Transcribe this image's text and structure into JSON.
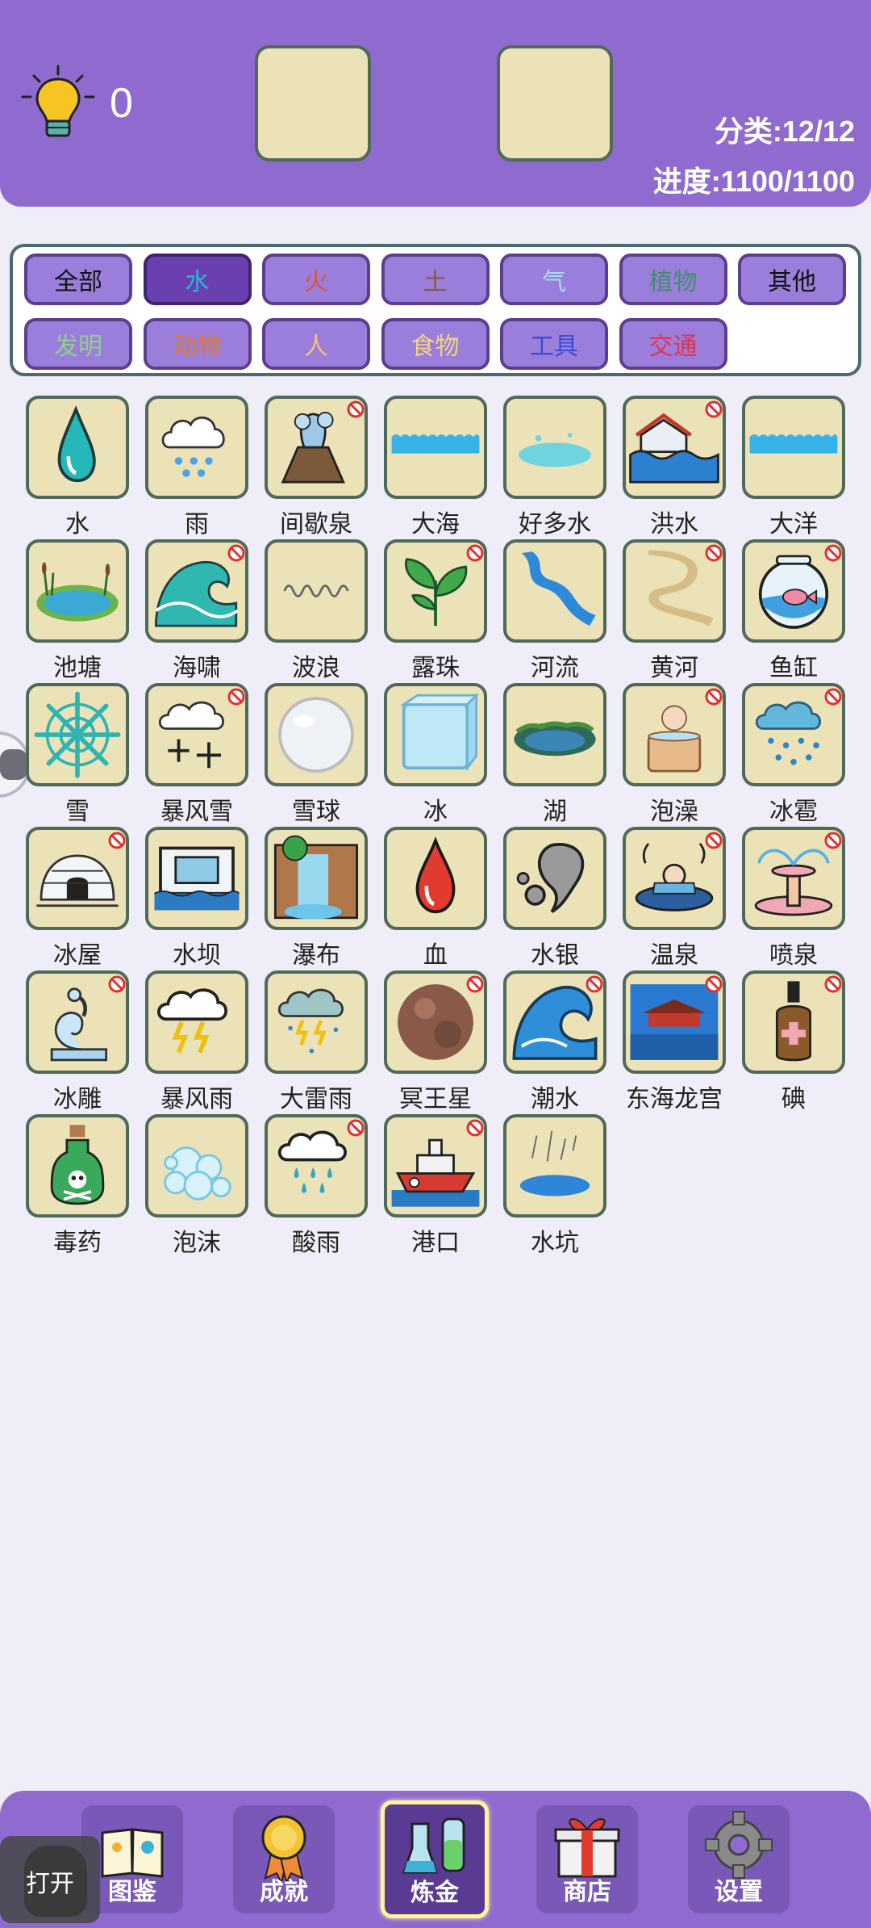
{
  "header": {
    "hint_count": "0",
    "category_stat": "分类:12/12",
    "progress_stat": "进度:1100/1100"
  },
  "filters": [
    {
      "label": "全部",
      "color": "#111111"
    },
    {
      "label": "水",
      "color": "#29b6d6"
    },
    {
      "label": "火",
      "color": "#e0533a"
    },
    {
      "label": "土",
      "color": "#8a5a32"
    },
    {
      "label": "气",
      "color": "#a9dcf2"
    },
    {
      "label": "植物",
      "color": "#3d8f6b"
    },
    {
      "label": "其他",
      "color": "#111111"
    },
    {
      "label": "发明",
      "color": "#8fd08a"
    },
    {
      "label": "动物",
      "color": "#e07a2a"
    },
    {
      "label": "人",
      "color": "#f3c27a"
    },
    {
      "label": "食物",
      "color": "#f1d57a"
    },
    {
      "label": "工具",
      "color": "#3a4bd4"
    },
    {
      "label": "交通",
      "color": "#e0354a"
    }
  ],
  "active_filter": "水",
  "elements": [
    {
      "name": "水",
      "icon": "water-drop-icon",
      "banned": false
    },
    {
      "name": "雨",
      "icon": "rain-cloud-icon",
      "banned": false
    },
    {
      "name": "间歇泉",
      "icon": "geyser-icon",
      "banned": true
    },
    {
      "name": "大海",
      "icon": "sea-icon",
      "banned": false
    },
    {
      "name": "好多水",
      "icon": "puddle-icon",
      "banned": false
    },
    {
      "name": "洪水",
      "icon": "flood-icon",
      "banned": true
    },
    {
      "name": "大洋",
      "icon": "ocean-icon",
      "banned": false
    },
    {
      "name": "池塘",
      "icon": "pond-icon",
      "banned": false
    },
    {
      "name": "海啸",
      "icon": "tsunami-icon",
      "banned": true
    },
    {
      "name": "波浪",
      "icon": "wave-line-icon",
      "banned": false
    },
    {
      "name": "露珠",
      "icon": "dew-plant-icon",
      "banned": true
    },
    {
      "name": "河流",
      "icon": "river-icon",
      "banned": false
    },
    {
      "name": "黄河",
      "icon": "yellow-river-icon",
      "banned": true
    },
    {
      "name": "鱼缸",
      "icon": "fishbowl-icon",
      "banned": true
    },
    {
      "name": "雪",
      "icon": "snowflake-icon",
      "banned": false
    },
    {
      "name": "暴风雪",
      "icon": "blizzard-icon",
      "banned": true
    },
    {
      "name": "雪球",
      "icon": "snowball-icon",
      "banned": false
    },
    {
      "name": "冰",
      "icon": "ice-cube-icon",
      "banned": false
    },
    {
      "name": "湖",
      "icon": "lake-icon",
      "banned": false
    },
    {
      "name": "泡澡",
      "icon": "bath-icon",
      "banned": true
    },
    {
      "name": "冰雹",
      "icon": "hail-icon",
      "banned": true
    },
    {
      "name": "冰屋",
      "icon": "igloo-icon",
      "banned": true
    },
    {
      "name": "水坝",
      "icon": "dam-icon",
      "banned": false
    },
    {
      "name": "瀑布",
      "icon": "waterfall-icon",
      "banned": false
    },
    {
      "name": "血",
      "icon": "blood-drop-icon",
      "banned": false
    },
    {
      "name": "水银",
      "icon": "mercury-icon",
      "banned": false
    },
    {
      "name": "温泉",
      "icon": "hot-spring-icon",
      "banned": true
    },
    {
      "name": "喷泉",
      "icon": "fountain-icon",
      "banned": true
    },
    {
      "name": "冰雕",
      "icon": "ice-swan-icon",
      "banned": true
    },
    {
      "name": "暴风雨",
      "icon": "storm-icon",
      "banned": false
    },
    {
      "name": "大雷雨",
      "icon": "thunderstorm-icon",
      "banned": false
    },
    {
      "name": "冥王星",
      "icon": "pluto-icon",
      "banned": true
    },
    {
      "name": "潮水",
      "icon": "tide-wave-icon",
      "banned": true
    },
    {
      "name": "东海龙宫",
      "icon": "dragon-palace-icon",
      "banned": true
    },
    {
      "name": "碘",
      "icon": "iodine-bottle-icon",
      "banned": true
    },
    {
      "name": "毒药",
      "icon": "poison-bottle-icon",
      "banned": false
    },
    {
      "name": "泡沫",
      "icon": "bubbles-icon",
      "banned": false
    },
    {
      "name": "酸雨",
      "icon": "acid-rain-icon",
      "banned": true
    },
    {
      "name": "港口",
      "icon": "harbor-ship-icon",
      "banned": true
    },
    {
      "name": "水坑",
      "icon": "rain-puddle-icon",
      "banned": false
    }
  ],
  "bottom_nav": [
    {
      "label": "图鉴",
      "icon": "book-icon",
      "active": false
    },
    {
      "label": "成就",
      "icon": "medal-icon",
      "active": false
    },
    {
      "label": "炼金",
      "icon": "flask-icon",
      "active": true
    },
    {
      "label": "商店",
      "icon": "gift-icon",
      "active": false
    },
    {
      "label": "设置",
      "icon": "gear-icon",
      "active": false
    }
  ],
  "open_button": "打开"
}
